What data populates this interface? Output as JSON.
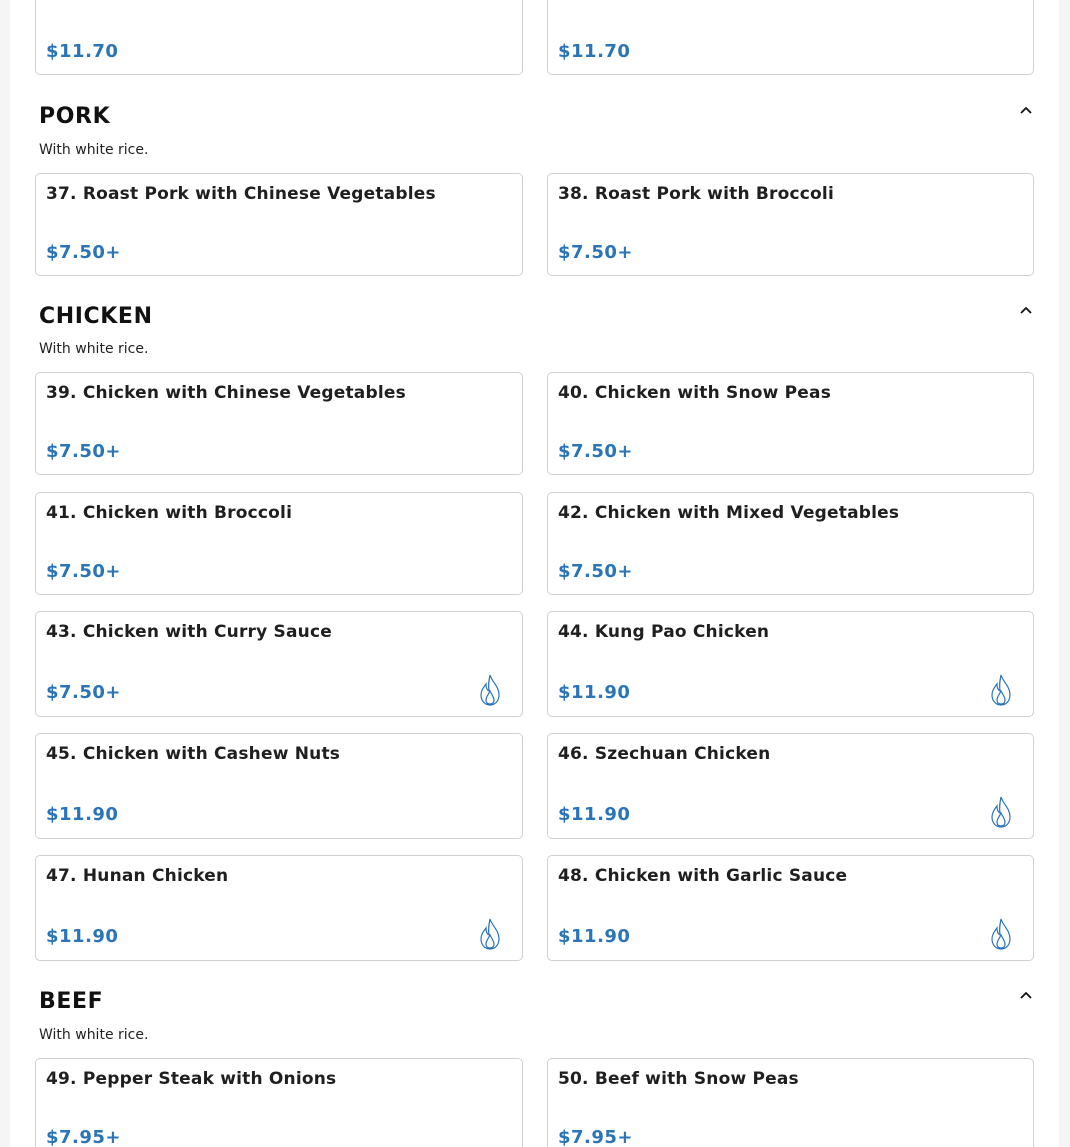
{
  "top_items": [
    {
      "name": "",
      "price": "$11.70"
    },
    {
      "name": "",
      "price": "$11.70"
    }
  ],
  "sections": {
    "pork": {
      "title": "PORK",
      "desc": "With white rice.",
      "items": [
        {
          "name": "37. Roast Pork with Chinese Vegetables",
          "price": "$7.50+",
          "spicy": false
        },
        {
          "name": "38. Roast Pork with Broccoli",
          "price": "$7.50+",
          "spicy": false
        }
      ]
    },
    "chicken": {
      "title": "CHICKEN",
      "desc": "With white rice.",
      "items": [
        {
          "name": "39. Chicken with Chinese Vegetables",
          "price": "$7.50+",
          "spicy": false
        },
        {
          "name": "40. Chicken with Snow Peas",
          "price": "$7.50+",
          "spicy": false
        },
        {
          "name": "41. Chicken with Broccoli",
          "price": "$7.50+",
          "spicy": false
        },
        {
          "name": "42. Chicken with Mixed Vegetables",
          "price": "$7.50+",
          "spicy": false
        },
        {
          "name": "43. Chicken with Curry Sauce",
          "price": "$7.50+",
          "spicy": true
        },
        {
          "name": "44. Kung Pao Chicken",
          "price": "$11.90",
          "spicy": true
        },
        {
          "name": "45. Chicken with Cashew Nuts",
          "price": "$11.90",
          "spicy": false
        },
        {
          "name": "46. Szechuan Chicken",
          "price": "$11.90",
          "spicy": true
        },
        {
          "name": "47. Hunan Chicken",
          "price": "$11.90",
          "spicy": true
        },
        {
          "name": "48. Chicken with Garlic Sauce",
          "price": "$11.90",
          "spicy": true
        }
      ]
    },
    "beef": {
      "title": "BEEF",
      "desc": "With white rice.",
      "items": [
        {
          "name": "49. Pepper Steak with Onions",
          "price": "$7.95+",
          "spicy": false
        },
        {
          "name": "50. Beef with Snow Peas",
          "price": "$7.95+",
          "spicy": false
        }
      ]
    }
  },
  "colors": {
    "price": "#2a74b8",
    "spicy_icon": "#2a74b8"
  },
  "icons": {
    "collapse": "chevron-up-icon",
    "spicy": "flame-icon"
  }
}
